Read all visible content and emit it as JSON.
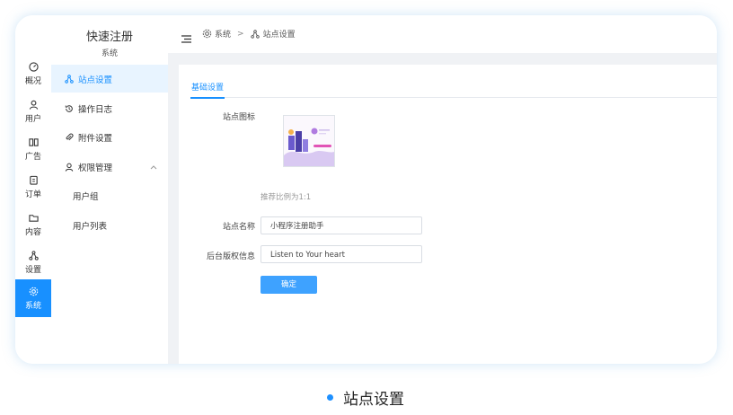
{
  "app": {
    "title": "快速注册",
    "subtitle": "系统"
  },
  "rail": {
    "items": [
      {
        "label": "概况",
        "icon": "dashboard-icon"
      },
      {
        "label": "用户",
        "icon": "user-icon"
      },
      {
        "label": "广告",
        "icon": "grid-icon"
      },
      {
        "label": "订单",
        "icon": "clipboard-icon"
      },
      {
        "label": "内容",
        "icon": "folder-icon"
      },
      {
        "label": "设置",
        "icon": "network-icon"
      },
      {
        "label": "系统",
        "icon": "gear-icon"
      }
    ],
    "active_index": 6,
    "active_color": "#1890ff"
  },
  "subnav": {
    "items": [
      {
        "label": "站点设置",
        "icon": "network-icon"
      },
      {
        "label": "操作日志",
        "icon": "history-icon"
      },
      {
        "label": "附件设置",
        "icon": "paperclip-icon"
      },
      {
        "label": "权限管理",
        "icon": "user-icon"
      },
      {
        "label": "用户组"
      },
      {
        "label": "用户列表"
      }
    ]
  },
  "breadcrumb": {
    "root": "系统",
    "separator": ">",
    "current": "站点设置"
  },
  "tabs": [
    {
      "label": "基础设置"
    }
  ],
  "form": {
    "icon_label": "站点图标",
    "icon_hint": "推荐比例为1:1",
    "name_label": "站点名称",
    "name_value": "小程序注册助手",
    "copyright_label": "后台版权信息",
    "copyright_value": "Listen to Your heart",
    "submit_label": "确定"
  },
  "caption": "站点设置",
  "colors": {
    "accent": "#1890ff",
    "button": "#3ea2ff",
    "content_bg": "#f0f2f5"
  }
}
